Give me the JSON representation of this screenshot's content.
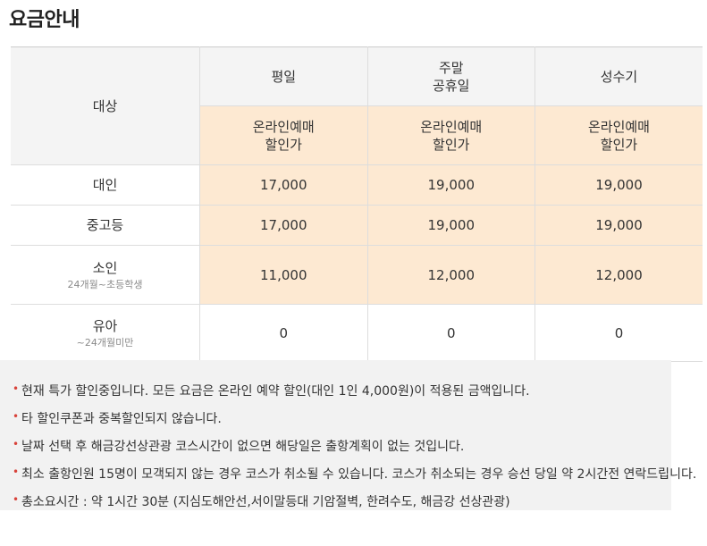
{
  "page": {
    "title": "요금안내"
  },
  "table": {
    "header": {
      "target": "대상",
      "days": [
        {
          "line1": "평일",
          "line2": ""
        },
        {
          "line1": "주말",
          "line2": "공휴일"
        },
        {
          "line1": "성수기",
          "line2": ""
        }
      ],
      "discount_label_line1": "온라인예매",
      "discount_label_line2": "할인가"
    },
    "rows": [
      {
        "label": "대인",
        "sub": "",
        "prices": [
          "17,000",
          "19,000",
          "19,000"
        ]
      },
      {
        "label": "중고등",
        "sub": "",
        "prices": [
          "17,000",
          "19,000",
          "19,000"
        ]
      },
      {
        "label": "소인",
        "sub": "24개월~초등학생",
        "prices": [
          "11,000",
          "12,000",
          "12,000"
        ]
      },
      {
        "label": "유아",
        "sub": "~24개월미만",
        "prices": [
          "0",
          "0",
          "0"
        ]
      }
    ]
  },
  "notes": [
    "현재 특가 할인중입니다. 모든 요금은 온라인 예약 할인(대인 1인 4,000원)이 적용된 금액입니다.",
    "타 할인쿠폰과 중복할인되지 않습니다.",
    "날짜 선택 후 해금강선상관광 코스시간이 없으면 해당일은 출항계획이 없는 것입니다.",
    "최소 출항인원 15명이 모객되지 않는 경우 코스가 취소될 수 있습니다. 코스가 취소되는 경우 승선 당일 약 2시간전 연락드립니다.",
    "총소요시간 : 약 1시간 30분 (지심도해안선,서이말등대 기암절벽, 한려수도, 해금강 선상관광)"
  ],
  "colors": {
    "header_bg": "#f4f4f4",
    "discount_bg": "#fde9d2",
    "bullet": "#d8423a",
    "border": "#dddddd"
  }
}
